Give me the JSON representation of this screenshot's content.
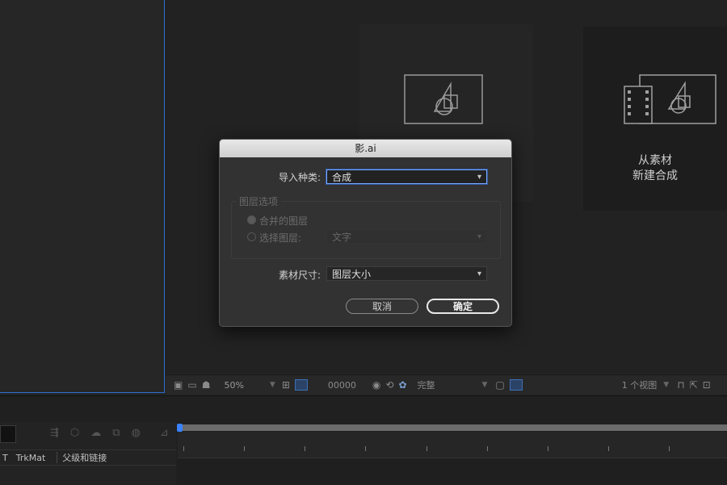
{
  "dialog": {
    "title": "影.ai",
    "import_kind_label": "导入种类:",
    "import_kind_value": "合成",
    "layer_options_title": "图层选项",
    "radio_merged_label": "合并的图层",
    "radio_choose_label": "选择图层:",
    "choose_layer_value": "文字",
    "footage_size_label": "素材尺寸:",
    "footage_size_value": "图层大小",
    "cancel_label": "取消",
    "ok_label": "确定"
  },
  "viewer": {
    "new_comp_line1": "从素材",
    "new_comp_line2": "新建合成"
  },
  "viewer_toolbar": {
    "zoom": "50%",
    "timecode": "00000",
    "resolution": "完整",
    "views": "1 个视图"
  },
  "timeline": {
    "col_t": "T",
    "col_trkmat": "TrkMat",
    "col_parent": "父级和链接"
  },
  "colors": {
    "accent_blue": "#3b82ff",
    "panel_border": "#2f6fd0",
    "dialog_bg": "#323232"
  }
}
